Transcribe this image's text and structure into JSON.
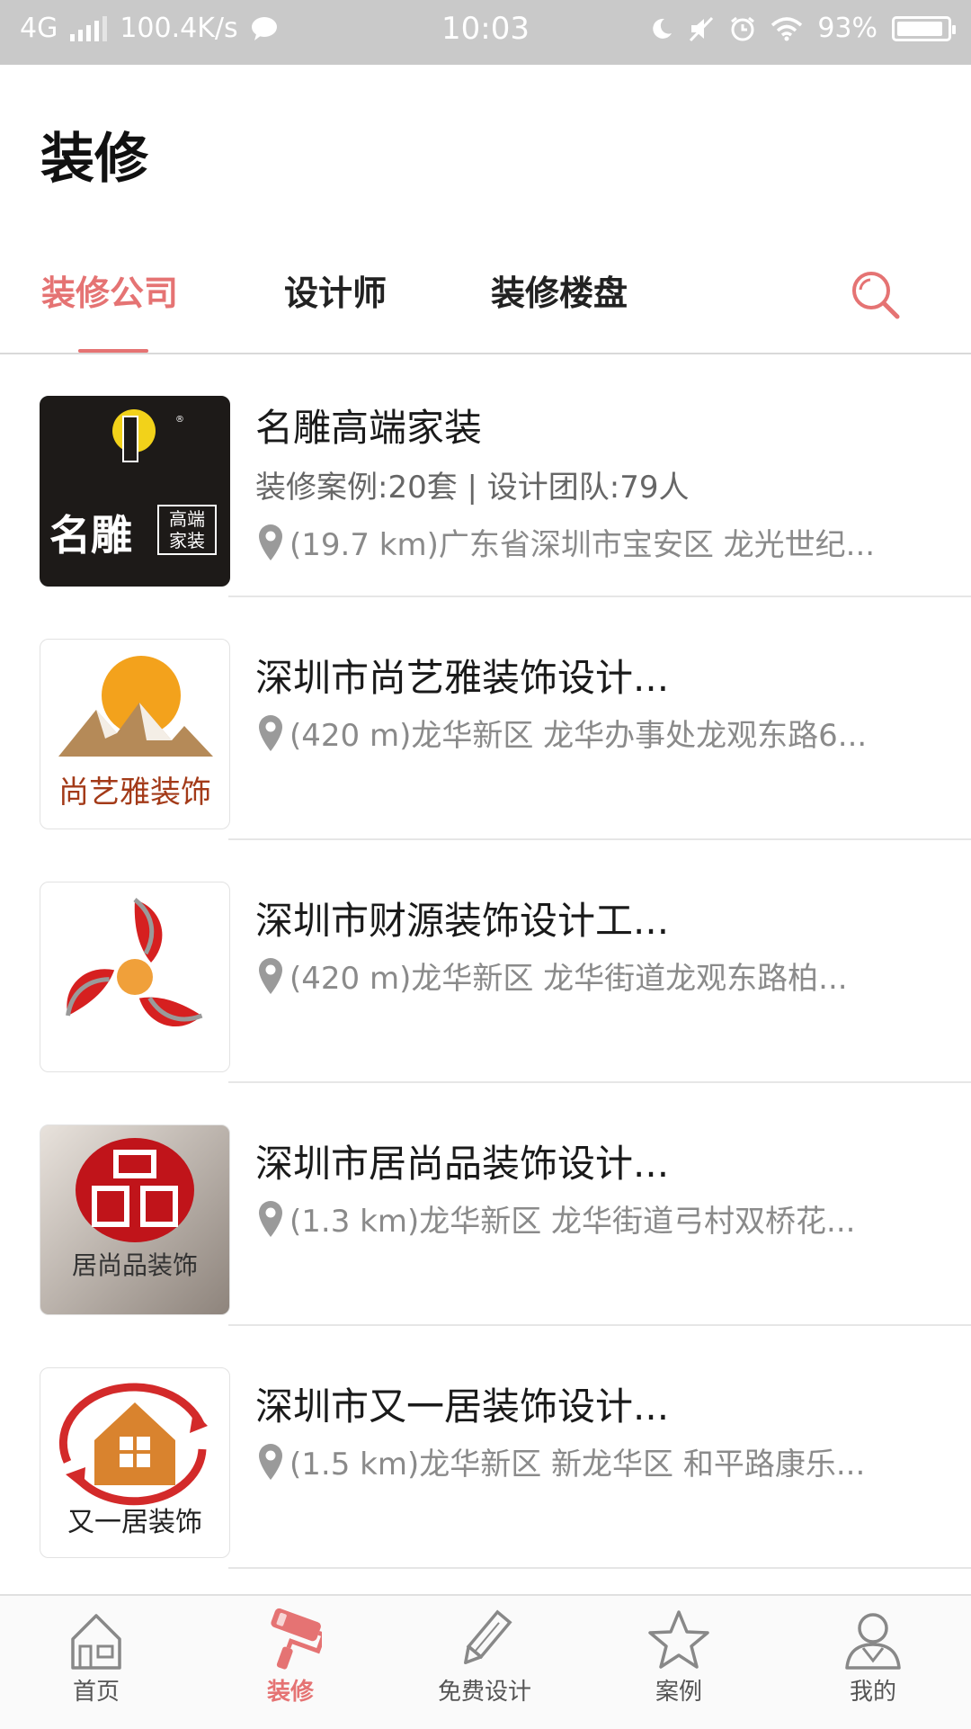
{
  "status_bar": {
    "network": "4G",
    "speed": "100.4K/s",
    "time": "10:03",
    "battery": "93%",
    "battery_level": 0.93
  },
  "header": {
    "title": "装修"
  },
  "tabs": [
    {
      "label": "装修公司",
      "active": true
    },
    {
      "label": "设计师",
      "active": false
    },
    {
      "label": "装修楼盘",
      "active": false
    }
  ],
  "companies": [
    {
      "name": "名雕高端家装",
      "stats": "装修案例:20套 | 设计团队:79人",
      "address": "(19.7 km)广东省深圳市宝安区 龙光世纪...",
      "logo_text_main": "名雕",
      "logo_text_side": "高端家装"
    },
    {
      "name": "深圳市尚艺雅装饰设计...",
      "address": "(420 m)龙华新区 龙华办事处龙观东路6...",
      "logo_text": "尚艺雅装饰"
    },
    {
      "name": "深圳市财源装饰设计工...",
      "address": "(420 m)龙华新区 龙华街道龙观东路柏..."
    },
    {
      "name": "深圳市居尚品装饰设计...",
      "address": "(1.3 km)龙华新区 龙华街道弓村双桥花...",
      "logo_text": "居尚品装饰"
    },
    {
      "name": "深圳市又一居装饰设计...",
      "address": "(1.5 km)龙华新区 新龙华区 和平路康乐...",
      "logo_text": "又一居装饰"
    }
  ],
  "bottom_nav": [
    {
      "label": "首页",
      "icon": "home-icon",
      "active": false
    },
    {
      "label": "装修",
      "icon": "paint-roller-icon",
      "active": true
    },
    {
      "label": "免费设计",
      "icon": "pencil-icon",
      "active": false
    },
    {
      "label": "案例",
      "icon": "star-icon",
      "active": false
    },
    {
      "label": "我的",
      "icon": "user-icon",
      "active": false
    }
  ],
  "colors": {
    "accent": "#e57373",
    "status_bar": "#c9c9c9"
  }
}
